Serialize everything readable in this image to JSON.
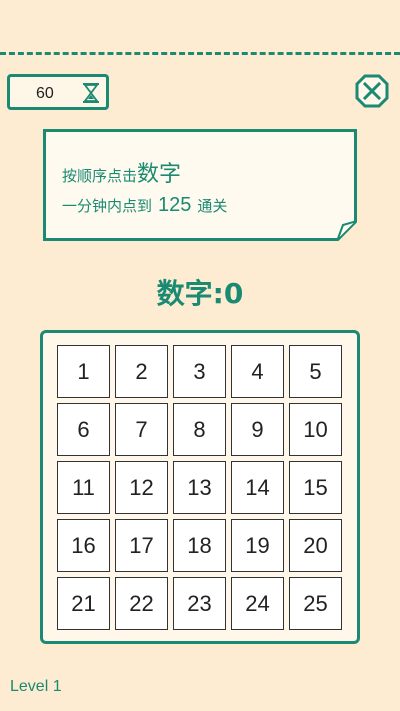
{
  "timer": {
    "seconds": "60",
    "icon": "hourglass-icon"
  },
  "close": {
    "icon": "close-icon"
  },
  "instructions": {
    "line1_prefix": "按顺序点击",
    "line1_emphasis": "数字",
    "line2_prefix": "一分钟内点到",
    "line2_target": "125",
    "line2_suffix": "通关"
  },
  "score": {
    "text": "数字:0"
  },
  "grid": {
    "cells": [
      "1",
      "2",
      "3",
      "4",
      "5",
      "6",
      "7",
      "8",
      "9",
      "10",
      "11",
      "12",
      "13",
      "14",
      "15",
      "16",
      "17",
      "18",
      "19",
      "20",
      "21",
      "22",
      "23",
      "24",
      "25"
    ]
  },
  "level": {
    "text": "Level 1"
  },
  "colors": {
    "accent": "#1a8a72",
    "background": "#fdebd2"
  }
}
